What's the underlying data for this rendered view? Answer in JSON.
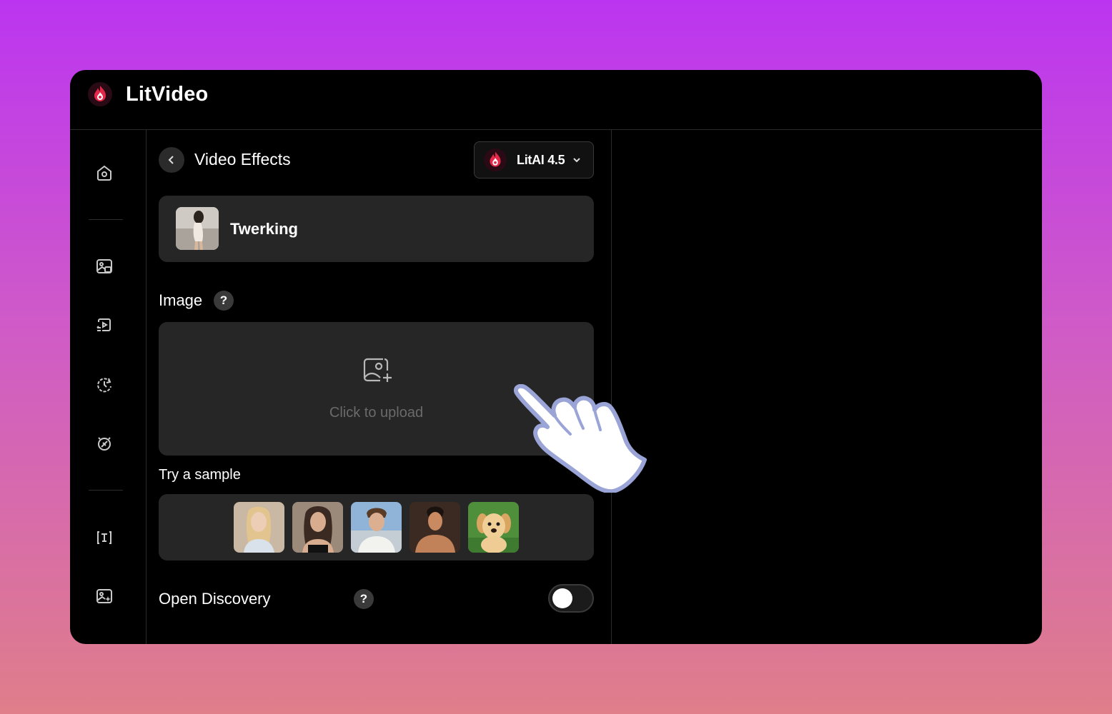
{
  "app": {
    "title": "LitVideo"
  },
  "colors": {
    "accent_red": "#e3284a",
    "background_top": "#bb35f0",
    "background_bottom": "#e07e8a",
    "panel_surface": "#262626"
  },
  "sidebar": {
    "items": [
      {
        "icon": "home-icon"
      },
      {
        "icon": "image-to-video-icon"
      },
      {
        "icon": "video-swap-icon"
      },
      {
        "icon": "history-icon"
      },
      {
        "icon": "effects-icon"
      },
      {
        "icon": "text-caption-icon"
      },
      {
        "icon": "gallery-icon"
      }
    ]
  },
  "panel": {
    "title": "Video Effects",
    "model": {
      "label": "LitAI 4.5"
    },
    "effect": {
      "name": "Twerking"
    },
    "image_section": {
      "label": "Image",
      "help": "?",
      "upload_text": "Click to upload"
    },
    "samples": {
      "label": "Try a sample",
      "items": [
        {
          "name": "sample-blonde-woman"
        },
        {
          "name": "sample-brunette-woman"
        },
        {
          "name": "sample-man-white-shirt"
        },
        {
          "name": "sample-man-shirtless"
        },
        {
          "name": "sample-puppy"
        }
      ]
    },
    "discovery": {
      "label": "Open Discovery",
      "help": "?",
      "enabled": false
    }
  }
}
